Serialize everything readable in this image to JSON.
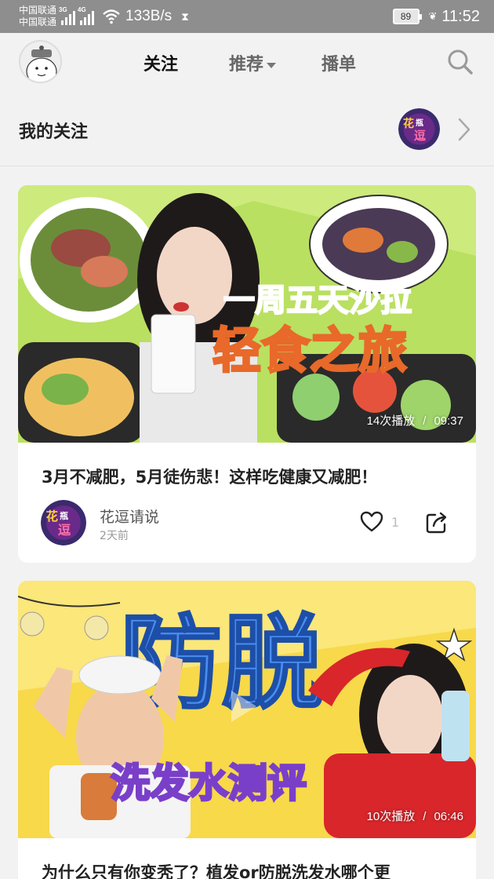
{
  "status_bar": {
    "carrier_1": "中国联通",
    "carrier_2": "中国联通",
    "net_1": "3G",
    "net_2": "4G",
    "speed": "133B/s",
    "battery": "89",
    "time": "11:52"
  },
  "nav": {
    "tabs": [
      {
        "label": "关注",
        "active": true
      },
      {
        "label": "推荐",
        "active": false
      },
      {
        "label": "播单",
        "active": false
      }
    ],
    "search_icon": "search-icon"
  },
  "follow": {
    "title": "我的关注",
    "avatar_text": "花瓶逗"
  },
  "cards": [
    {
      "thumb_line1": "一周五天沙拉",
      "thumb_line2": "轻食之旅",
      "plays": "14次播放",
      "duration": "09:37",
      "title": "3月不减肥，5月徒伤悲！这样吃健康又减肥！",
      "author": "花逗请说",
      "time": "2天前",
      "likes": "1"
    },
    {
      "thumb_line1": "防脱",
      "thumb_line2": "洗发水测评",
      "plays": "10次播放",
      "duration": "06:46",
      "title": "为什么只有你变秃了？植发or防脱洗发水哪个更"
    }
  ],
  "colors": {
    "status_bg": "#8e8e8e",
    "page_bg": "#f2f2f2",
    "salad_bg": "#b9e060",
    "shampoo_bg": "#f7d94a",
    "title_orange": "#f5a11c",
    "title_blue": "#4a8ef0"
  }
}
